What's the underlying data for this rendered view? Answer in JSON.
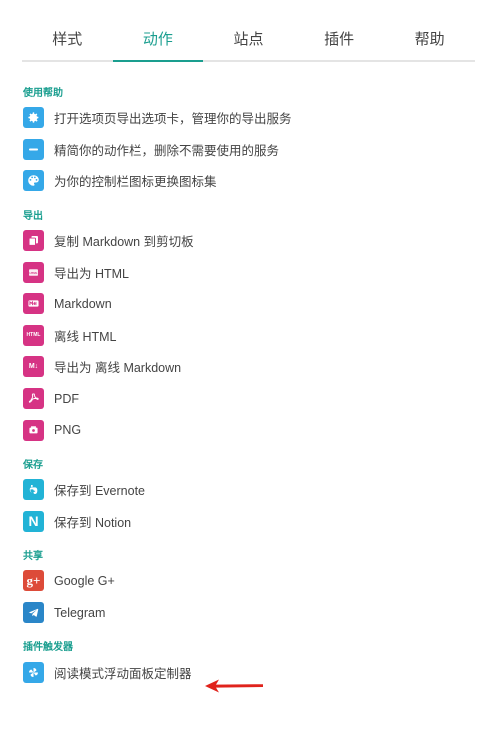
{
  "tabs": [
    {
      "label": "样式",
      "active": false
    },
    {
      "label": "动作",
      "active": true
    },
    {
      "label": "站点",
      "active": false
    },
    {
      "label": "插件",
      "active": false
    },
    {
      "label": "帮助",
      "active": false
    }
  ],
  "sections": {
    "help": {
      "title": "使用帮助",
      "items": [
        {
          "label": "打开选项页导出选项卡，管理你的导出服务",
          "icon": "gear-icon",
          "color": "#35a8e8"
        },
        {
          "label": "精简你的动作栏，删除不需要使用的服务",
          "icon": "minus-icon",
          "color": "#35a8e8"
        },
        {
          "label": "为你的控制栏图标更换图标集",
          "icon": "palette-icon",
          "color": "#35a8e8"
        }
      ]
    },
    "export": {
      "title": "导出",
      "items": [
        {
          "label": "复制 Markdown 到剪切板",
          "icon": "copy-icon",
          "color": "#d63384"
        },
        {
          "label": "导出为 HTML",
          "icon": "html-file-icon",
          "color": "#d63384"
        },
        {
          "label": "Markdown",
          "icon": "markdown-icon",
          "color": "#d63384"
        },
        {
          "label": "离线 HTML",
          "icon": "offline-html-icon",
          "color": "#d63384"
        },
        {
          "label": "导出为 离线 Markdown",
          "icon": "markdown-download-icon",
          "color": "#d63384"
        },
        {
          "label": "PDF",
          "icon": "pdf-icon",
          "color": "#d63384"
        },
        {
          "label": "PNG",
          "icon": "image-icon",
          "color": "#d63384"
        }
      ]
    },
    "save": {
      "title": "保存",
      "items": [
        {
          "label": "保存到 Evernote",
          "icon": "evernote-icon",
          "color": "#22b3d6"
        },
        {
          "label": "保存到 Notion",
          "icon": "notion-icon",
          "color": "#22b3d6"
        }
      ]
    },
    "share": {
      "title": "共享",
      "items": [
        {
          "label": "Google G+",
          "icon": "google-plus-icon",
          "color": "#dd4b39"
        },
        {
          "label": "Telegram",
          "icon": "telegram-icon",
          "color": "#2a86c8"
        }
      ]
    },
    "plugin": {
      "title": "插件触发器",
      "items": [
        {
          "label": "阅读模式浮动面板定制器",
          "icon": "pinwheel-icon",
          "color": "#35a8e8"
        }
      ]
    }
  },
  "glyphs": {
    "markdown": "M↓",
    "html": "HTML",
    "notion": "N",
    "gplus": "g+"
  },
  "colors": {
    "accent": "#1a9e8f",
    "arrow": "#e0231c"
  }
}
